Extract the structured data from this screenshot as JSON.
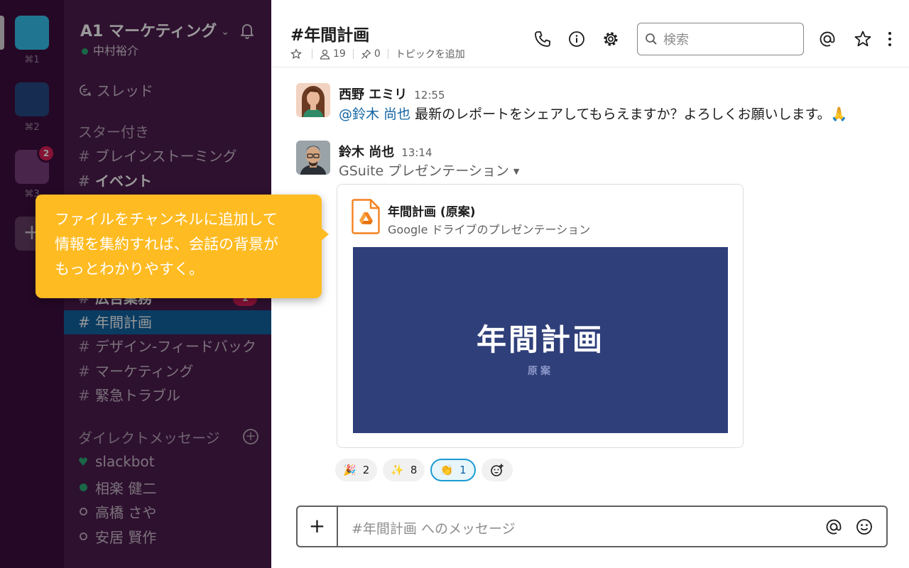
{
  "workspaces": [
    {
      "shortcut": "⌘1",
      "color": "#36c5f0"
    },
    {
      "shortcut": "⌘2",
      "color": "#264a86"
    },
    {
      "shortcut": "⌘3",
      "color": "#7b3d7d",
      "badge": "2"
    }
  ],
  "workspace_add": "+",
  "sidebar": {
    "workspace_name": "A1 マーケティング",
    "user_name": "中村裕介",
    "threads_label": "スレッド",
    "starred_header": "スター付き",
    "hash": "#",
    "channels": [
      {
        "name": "ブレインストーミング"
      },
      {
        "name": "イベント"
      },
      {
        "name": "広告業務",
        "badge": "1"
      },
      {
        "name": "年間計画"
      },
      {
        "name": "デザイン-フィードバック"
      },
      {
        "name": "マーケティング"
      },
      {
        "name": "緊急トラブル"
      }
    ],
    "dm_header": "ダイレクトメッセージ",
    "dms": [
      {
        "name": "slackbot"
      },
      {
        "name": "相楽 健二"
      },
      {
        "name": "高橋 さや"
      },
      {
        "name": "安居 賢作"
      }
    ]
  },
  "header": {
    "channel_title": "#年間計画",
    "members": "19",
    "pins": "0",
    "topic_placeholder": "トピックを追加",
    "search_placeholder": "検索"
  },
  "messages": [
    {
      "author": "西野 エミリ",
      "time": "12:55",
      "mention": "@鈴木 尚也",
      "text": " 最新のレポートをシェアしてもらえますか？よろしくお願いします。🙏"
    },
    {
      "author": "鈴木 尚也",
      "time": "13:14",
      "attachment_label": "GSuite プレゼンテーション",
      "file": {
        "title": "年間計画 (原案)",
        "subtitle": "Google ドライブのプレゼンテーション",
        "slide_title": "年間計画",
        "slide_subtitle": "原案"
      },
      "reactions": [
        {
          "emoji": "🎉",
          "count": "2"
        },
        {
          "emoji": "✨",
          "count": "8"
        },
        {
          "emoji": "👏",
          "count": "1",
          "selected": true
        }
      ]
    }
  ],
  "composer": {
    "plus": "+",
    "placeholder": "#年間計画 へのメッセージ"
  },
  "tooltip": {
    "text": "ファイルをチャンネルに追加して\n情報を集約すれば、会話の背景が\nもっとわかりやすく。"
  },
  "colors": {
    "rail": "#3f0e40",
    "sidebar": "#4d1b4f",
    "active_channel": "#1164a3",
    "badge": "#e01e5a",
    "presence": "#2bac76",
    "tooltip": "#ffbb22",
    "mention": "#1264a3"
  }
}
